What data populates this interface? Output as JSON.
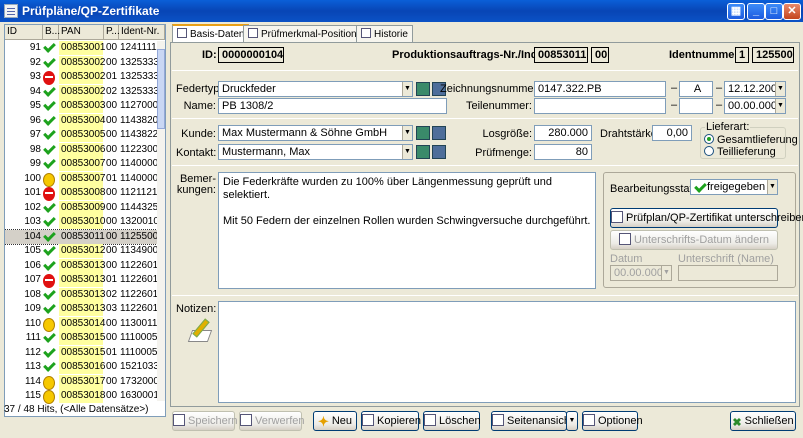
{
  "window": {
    "title": "Prüfpläne/QP-Zertifikate"
  },
  "list": {
    "columns": [
      "ID",
      "B...",
      "PAN",
      "P...",
      "Ident-Nr."
    ],
    "rows": [
      {
        "id": "91",
        "status": "ok",
        "pan": "00853001",
        "p": "00",
        "ident": "1241111"
      },
      {
        "id": "92",
        "status": "ok",
        "pan": "00853002",
        "p": "00",
        "ident": "1325333"
      },
      {
        "id": "93",
        "status": "blocked",
        "pan": "00853002",
        "p": "01",
        "ident": "1325333"
      },
      {
        "id": "94",
        "status": "ok",
        "pan": "00853002",
        "p": "02",
        "ident": "1325333"
      },
      {
        "id": "95",
        "status": "ok",
        "pan": "00853003",
        "p": "00",
        "ident": "1127000"
      },
      {
        "id": "96",
        "status": "ok",
        "pan": "00853004",
        "p": "00",
        "ident": "1143820"
      },
      {
        "id": "97",
        "status": "ok",
        "pan": "00853005",
        "p": "00",
        "ident": "1143822"
      },
      {
        "id": "98",
        "status": "ok",
        "pan": "00853006",
        "p": "00",
        "ident": "1122300"
      },
      {
        "id": "99",
        "status": "ok",
        "pan": "00853007",
        "p": "00",
        "ident": "1140000"
      },
      {
        "id": "100",
        "status": "warn",
        "pan": "00853007",
        "p": "01",
        "ident": "1140000"
      },
      {
        "id": "101",
        "status": "blocked",
        "pan": "00853008",
        "p": "00",
        "ident": "1121121"
      },
      {
        "id": "102",
        "status": "ok",
        "pan": "00853009",
        "p": "00",
        "ident": "1144325"
      },
      {
        "id": "103",
        "status": "ok",
        "pan": "00853010",
        "p": "00",
        "ident": "1320010"
      },
      {
        "id": "104",
        "status": "ok",
        "pan": "00853011",
        "p": "00",
        "ident": "1125500",
        "selected": true
      },
      {
        "id": "105",
        "status": "ok",
        "pan": "00853012",
        "p": "00",
        "ident": "1134900"
      },
      {
        "id": "106",
        "status": "ok",
        "pan": "00853013",
        "p": "00",
        "ident": "1122601"
      },
      {
        "id": "107",
        "status": "blocked",
        "pan": "00853013",
        "p": "01",
        "ident": "1122601"
      },
      {
        "id": "108",
        "status": "ok",
        "pan": "00853013",
        "p": "02",
        "ident": "1122601"
      },
      {
        "id": "109",
        "status": "ok",
        "pan": "00853013",
        "p": "03",
        "ident": "1122601"
      },
      {
        "id": "110",
        "status": "warn",
        "pan": "00853014",
        "p": "00",
        "ident": "1130011"
      },
      {
        "id": "111",
        "status": "ok",
        "pan": "00853015",
        "p": "00",
        "ident": "1110005"
      },
      {
        "id": "112",
        "status": "ok",
        "pan": "00853015",
        "p": "01",
        "ident": "1110005"
      },
      {
        "id": "113",
        "status": "ok",
        "pan": "00853016",
        "p": "00",
        "ident": "1521033"
      },
      {
        "id": "114",
        "status": "warn",
        "pan": "00853017",
        "p": "00",
        "ident": "1732000"
      },
      {
        "id": "115",
        "status": "warn",
        "pan": "00853018",
        "p": "00",
        "ident": "1630001"
      }
    ],
    "status_text": "37 / 48 Hits, (<Alle Datensätze>)"
  },
  "tabs": [
    {
      "label": "Basis-Daten",
      "active": true
    },
    {
      "label": "Prüfmerkmal-Positionen",
      "active": false
    },
    {
      "label": "Historie",
      "active": false
    }
  ],
  "header": {
    "id_label": "ID:",
    "id_value": "0000000104",
    "pa_label": "Produktionsauftrags-Nr./Index:",
    "pa_value": "00853011",
    "pa_index": "00",
    "ident_label": "Identnummer:",
    "ident_prefix": "1",
    "ident_value": "125500"
  },
  "part": {
    "federtyp_label": "Federtyp:",
    "federtyp_value": "Druckfeder",
    "name_label": "Name:",
    "name_value": "PB 1308/2",
    "zeichnung_label": "Zeichnungsnummer:",
    "zeichnung_value": "0147.322.PB",
    "zeichnung_index": "A",
    "zeichnung_date": "12.12.2007",
    "teil_label": "Teilenummer:",
    "teil_value": "",
    "teil_mid": "",
    "teil_date": "00.00.0000"
  },
  "customer": {
    "kunde_label": "Kunde:",
    "kunde_value": "Max Mustermann & Söhne GmbH",
    "kontakt_label": "Kontakt:",
    "kontakt_value": "Mustermann, Max",
    "losgroesse_label": "Losgröße:",
    "losgroesse_value": "280.000",
    "pruefmenge_label": "Prüfmenge:",
    "pruefmenge_value": "80",
    "draht_label": "Drahtstärke:",
    "draht_value": "0,00",
    "lieferart_label": "Lieferart:",
    "lieferart_options": [
      "Gesamtlieferung",
      "Teillieferung"
    ],
    "lieferart_selected": 0
  },
  "remarks": {
    "label_line1": "Bemer-",
    "label_line2": "kungen:",
    "line1": "Die Federkräfte wurden zu 100% über Längenmessung geprüft und selektiert.",
    "line2": "Mit 50 Federn der einzelnen Rollen wurden Schwingversuche durchgeführt."
  },
  "processing": {
    "status_label": "Bearbeitungsstatus:",
    "status_value": "freigegeben",
    "sign_button": "Prüfplan/QP-Zertifikat unterschreiben",
    "change_date_button": "Unterschrifts-Datum ändern",
    "datum_label": "Datum",
    "datum_value": "00.00.0000",
    "unterschrift_label": "Unterschrift (Name)",
    "unterschrift_value": ""
  },
  "notes": {
    "label": "Notizen:",
    "value": ""
  },
  "toolbar": {
    "save": "Speichern",
    "discard": "Verwerfen",
    "new": "Neu",
    "copy": "Kopieren",
    "delete": "Löschen",
    "page_view": "Seitenansicht",
    "options": "Optionen",
    "close": "Schließen"
  },
  "colors": {
    "title_bar": "#0A5FD8",
    "pan_highlight": "#FFFFA0",
    "ok": "#1DA21D",
    "blocked": "#E01010",
    "warn": "#F6C800"
  }
}
